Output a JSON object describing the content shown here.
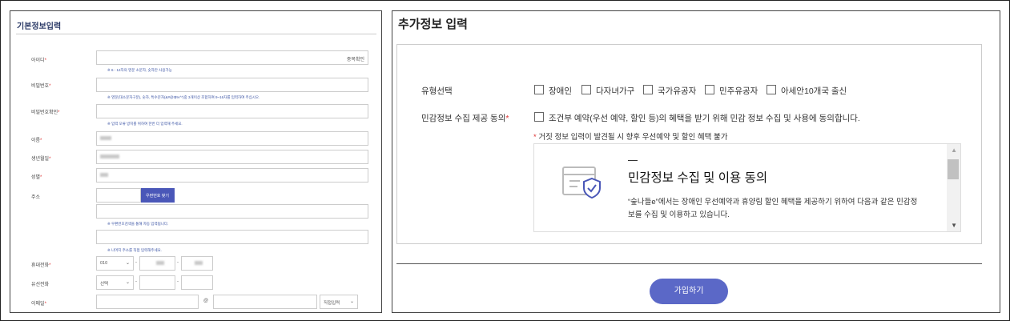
{
  "basic_info": {
    "title": "기본정보입력",
    "user_id": {
      "label": "아이디",
      "req": "*",
      "check_button": "중복확인",
      "hint": "※ 6 - 12자의 영문 소문자, 숫자만 사용가능"
    },
    "password": {
      "label": "비밀번호",
      "req": "*",
      "hint": "※ 영문(대소문자구분), 숫자, 특수문자(&#@!$%^*)중 3개이상 조합하여 9~16자를 입력하여 주십시오."
    },
    "password_confirm": {
      "label": "비밀번호확인",
      "req": "*",
      "hint": "※ 입력 오류 방지를 위하여 한번 더 입력해 주세요."
    },
    "name": {
      "label": "이름",
      "req": "*"
    },
    "birthdate": {
      "label": "생년월일",
      "req": "*"
    },
    "gender": {
      "label": "성별",
      "req": "*"
    },
    "address": {
      "label": "주소",
      "postcode_button": "우편번호 찾기",
      "hint1": "※ 우편번호검색을 통해 자동 입력됩니다.",
      "hint2": "※ 나머지 주소를 직접 입력해주세요."
    },
    "mobile": {
      "label": "휴대전화",
      "req": "*",
      "prefix": "010",
      "sep": "-"
    },
    "landline": {
      "label": "유선전화",
      "prefix": "선택",
      "sep": "-"
    },
    "email": {
      "label": "이메일",
      "req": "*",
      "at": "@",
      "domain_select": "직접입력"
    }
  },
  "extra_info": {
    "title": "추가정보 입력",
    "type_select": {
      "label": "유형선택",
      "options": [
        "장애인",
        "다자녀가구",
        "국가유공자",
        "민주유공자",
        "아세안10개국 출신"
      ]
    },
    "consent": {
      "label": "민감정보 수집 제공 동의",
      "req": "*",
      "text": "조건부 예약(우선 예약, 할인 등)의 혜택을 받기 위해 민감 정보 수집 및 사용에 동의합니다."
    },
    "warning": {
      "star": "*",
      "text": " 거짓 정보 입력이 발견될 시 향후 우선예약 및 할인 혜택 불가"
    },
    "terms": {
      "title": "민감정보 수집 및 이용 동의",
      "body": "“숲나들e”에서는 장애인 우선예약과 휴양림 할인 혜택을 제공하기 위하여 다음과 같은 민감정보를 수집 및 이용하고 있습니다."
    },
    "submit_label": "가입하기"
  },
  "colors": {
    "accent": "#5b68c7",
    "title_blue": "#2b3a67",
    "required": "#d33333"
  },
  "icons": [
    "chevron-down-icon",
    "shield-document-icon",
    "scroll-up-icon",
    "scroll-down-icon"
  ]
}
